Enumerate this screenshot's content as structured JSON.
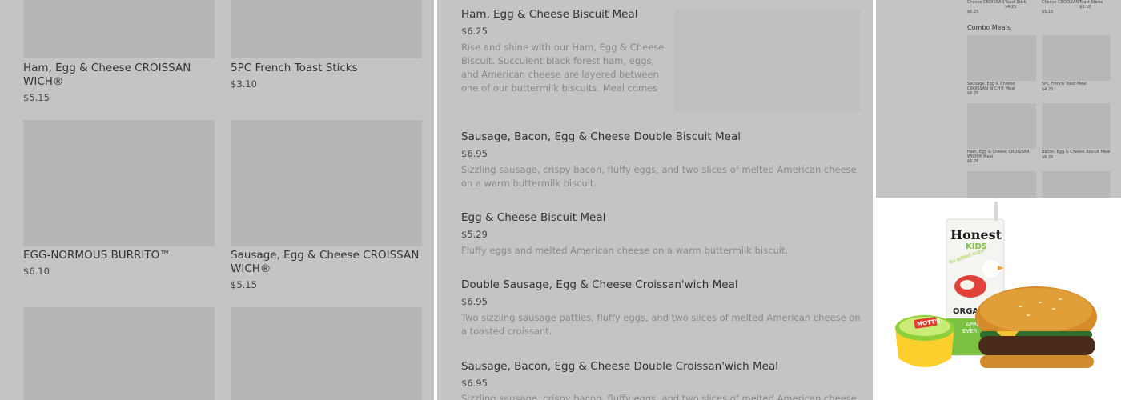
{
  "grid": {
    "items": [
      {
        "name": "Ham, Egg & Cheese CROISSAN WICH®",
        "price": "$5.15"
      },
      {
        "name": "5PC French Toast Sticks",
        "price": "$3.10"
      },
      {
        "name": "EGG-NORMOUS BURRITO™",
        "price": "$6.10"
      },
      {
        "name": "Sausage, Egg & Cheese CROISSAN WICH®",
        "price": "$5.15"
      }
    ]
  },
  "list": {
    "items": [
      {
        "name": "Ham, Egg & Cheese Biscuit Meal",
        "price": "$6.25",
        "desc": "Rise and shine with our Ham, Egg & Cheese Biscuit. Succulent black forest ham, eggs, and American cheese are layered between one of our buttermilk biscuits. Meal comes in mediu..."
      },
      {
        "name": "Sausage, Bacon, Egg & Cheese Double Biscuit Meal",
        "price": "$6.95",
        "desc": "Sizzling sausage, crispy bacon, fluffy eggs, and two slices of melted American cheese on a warm buttermilk biscuit."
      },
      {
        "name": "Egg & Cheese Biscuit Meal",
        "price": "$5.29",
        "desc": "Fluffy eggs and melted American cheese on a warm buttermilk biscuit."
      },
      {
        "name": "Double Sausage, Egg & Cheese Croissan'wich Meal",
        "price": "$6.95",
        "desc": "Two sizzling sausage patties, fluffy eggs, and two slices of melted American cheese on a toasted croissant."
      },
      {
        "name": "Sausage, Bacon, Egg & Cheese Double Croissan'wich Meal",
        "price": "$6.95",
        "desc": "Sizzling sausage, crispy bacon, fluffy eggs, and two slices of melted American cheese on a"
      }
    ]
  },
  "mini": {
    "top_row": [
      {
        "name": "Cheese CROISSAN",
        "price": "$6.25"
      },
      {
        "name": "Toast Stick",
        "price": "$4.25"
      },
      {
        "name": "Cheese CROISSAN",
        "price": "$5.15"
      },
      {
        "name": "Toast Sticks",
        "price": "$3.10"
      }
    ],
    "section_title": "Combo Meals",
    "items": [
      {
        "name": "Sausage, Egg & Cheese CROISSAN WICH® Meal",
        "price": "$6.25"
      },
      {
        "name": "5PC French Toast Meal",
        "price": "$4.25"
      },
      {
        "name": "Ham, Egg & Cheese CROISSAN WICH® Meal",
        "price": "$6.25"
      },
      {
        "name": "Bacon, Egg & Cheese Biscuit Meal",
        "price": "$6.25"
      }
    ]
  },
  "kids_meal": {
    "juice_brand": "Honest",
    "juice_sub": "KIDS",
    "juice_note": "No added sugar",
    "juice_organic": "ORGAN",
    "juice_flavor": "APPL",
    "juice_flavor2": "EVER",
    "applesauce_brand": "MOTT'S"
  }
}
